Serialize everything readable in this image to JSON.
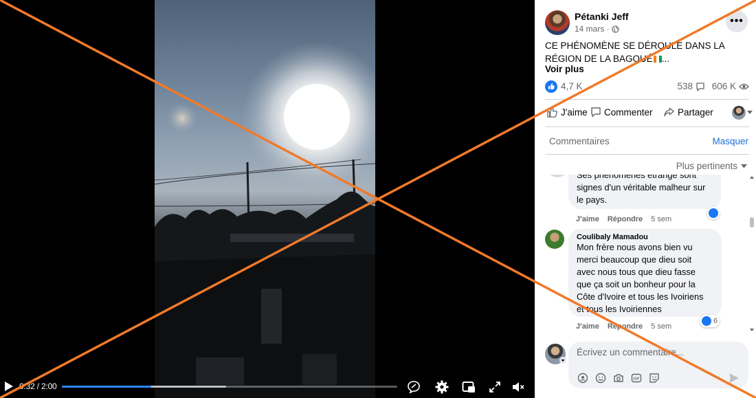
{
  "video": {
    "time_current": "0:32",
    "time_separator": " / ",
    "time_total": "2:00",
    "progress_fraction": 0.267,
    "buffered_fraction": 0.49
  },
  "post": {
    "author": "Pétanki Jeff",
    "date": "14 mars · ",
    "text": "CE PHÉNOMÈNE SE DÉROULE DANS LA RÉGION DE LA BAGOUÉ",
    "text_ellipsis": "...",
    "see_more": "Voir plus",
    "likes": "4,7 K",
    "comments": "538",
    "views": "606 K"
  },
  "actions": {
    "like": "J'aime",
    "comment": "Commenter",
    "share": "Partager"
  },
  "comments_section": {
    "title": "Commentaires",
    "hide": "Masquer",
    "sort": "Plus pertinents"
  },
  "comments": [
    {
      "lines": [
        "Ses phénomènes étrange sont",
        "signes d'un véritable malheur sur",
        "le pays."
      ],
      "like_label": "J'aime",
      "reply_label": "Répondre",
      "time": "5 sem"
    },
    {
      "author": "Coulibaly Mamadou",
      "lines": [
        "Mon frère nous avons bien vu",
        "merci beaucoup que dieu soit",
        "avec nous tous que dieu fasse",
        "que ça soit un bonheur pour la",
        "Côte d'Ivoire et tous les Ivoiriens",
        "et tous les Ivoiriennes"
      ],
      "reactions": "6",
      "like_label": "J'aime",
      "reply_label": "Répondre",
      "time": "5 sem"
    }
  ],
  "composer": {
    "placeholder": "Écrivez un commentaire..."
  },
  "colors": {
    "accent": "#1877f2",
    "cross": "#f07a2a",
    "link": "#216fdb"
  }
}
